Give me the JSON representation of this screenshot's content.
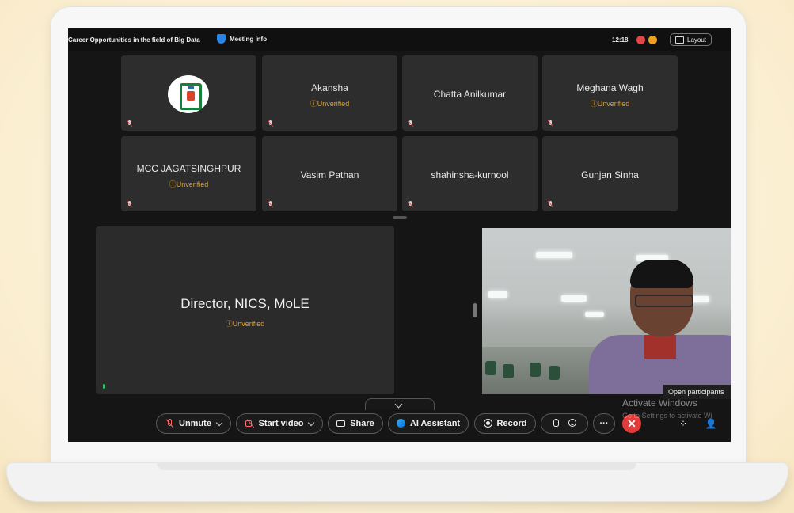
{
  "meeting": {
    "title": "Career Opportunities in the field of Big Data",
    "info_label": "Meeting Info",
    "time": "12:18",
    "layout_label": "Layout"
  },
  "participants": [
    {
      "name": "",
      "status": "",
      "logo": "organization-logo"
    },
    {
      "name": "Akansha",
      "status": "Unverified"
    },
    {
      "name": "Chatta Anilkumar",
      "status": ""
    },
    {
      "name": "Meghana Wagh",
      "status": "Unverified"
    },
    {
      "name": "MCC JAGATSINGHPUR",
      "status": "Unverified"
    },
    {
      "name": "Vasim Pathan",
      "status": ""
    },
    {
      "name": "shahinsha-kurnool",
      "status": ""
    },
    {
      "name": "Gunjan Sinha",
      "status": ""
    }
  ],
  "stage": {
    "name": "Director, NICS, MoLE",
    "status": "Unverified"
  },
  "controls": {
    "unmute": "Unmute",
    "start_video": "Start video",
    "share": "Share",
    "ai_assistant": "AI Assistant",
    "record": "Record",
    "more": "···"
  },
  "tooltip": "Open participants",
  "watermark": {
    "line1": "Activate Windows",
    "line2": "Go to Settings to activate Wi"
  },
  "colors": {
    "unverified": "#e3a12a",
    "end_call": "#e33b3b",
    "ai_accent": "#2fb4ff"
  }
}
